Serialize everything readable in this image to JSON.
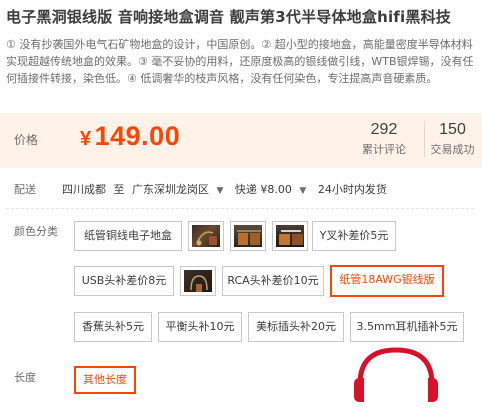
{
  "product": {
    "title": "电子黑洞银线版 音响接地盒调音 靓声第3代半导体地盒hifi黑科技",
    "description": "① 没有抄袭国外电气石矿物地盒的设计，中国原创。② 超小型的接地盒，高能量密度半导体材料实现超越传统地盒的效果。③ 毫不妥协的用料，还原度极高的银线做引线，WTB银焊锡，没有任何插接件转接，染色低。④ 低调奢华的枝声风格，没有任何染色，专注提高声音硬素质。"
  },
  "price": {
    "label": "价格",
    "currency": "¥",
    "value": "149.00"
  },
  "stats": {
    "reviews_count": "292",
    "reviews_label": "累计评论",
    "deals_count": "150",
    "deals_label": "交易成功"
  },
  "shipping": {
    "label": "配送",
    "from": "四川成都",
    "to_word": "至",
    "destination": "广东深圳龙岗区",
    "method": "快递 ¥8.00",
    "dispatch": "24小时内发货"
  },
  "color": {
    "label": "颜色分类",
    "options": [
      {
        "label": "纸管铜线电子地盒"
      },
      {
        "label": "",
        "image": true
      },
      {
        "label": "",
        "image": true
      },
      {
        "label": "",
        "image": true
      },
      {
        "label": "Y叉补差价5元"
      },
      {
        "label": "USB头补差价8元"
      },
      {
        "label": "",
        "image": true
      },
      {
        "label": "RCA头补差价10元"
      },
      {
        "label": "纸管18AWG银线版",
        "selected": true
      },
      {
        "label": "香蕉头补5元"
      },
      {
        "label": "平衡头补10元"
      },
      {
        "label": "美标插头补20元"
      },
      {
        "label": "3.5mm耳机插补5元"
      }
    ]
  },
  "length": {
    "label": "长度",
    "options": [
      {
        "label": "其他长度",
        "selected": true
      }
    ]
  },
  "colors": {
    "accent": "#ff4400",
    "price_bg": "#fff2e8",
    "logo_red": "#d8102a"
  },
  "icons": {
    "dropdown": "chevron-down-icon",
    "watermark": "headphone-icon"
  }
}
